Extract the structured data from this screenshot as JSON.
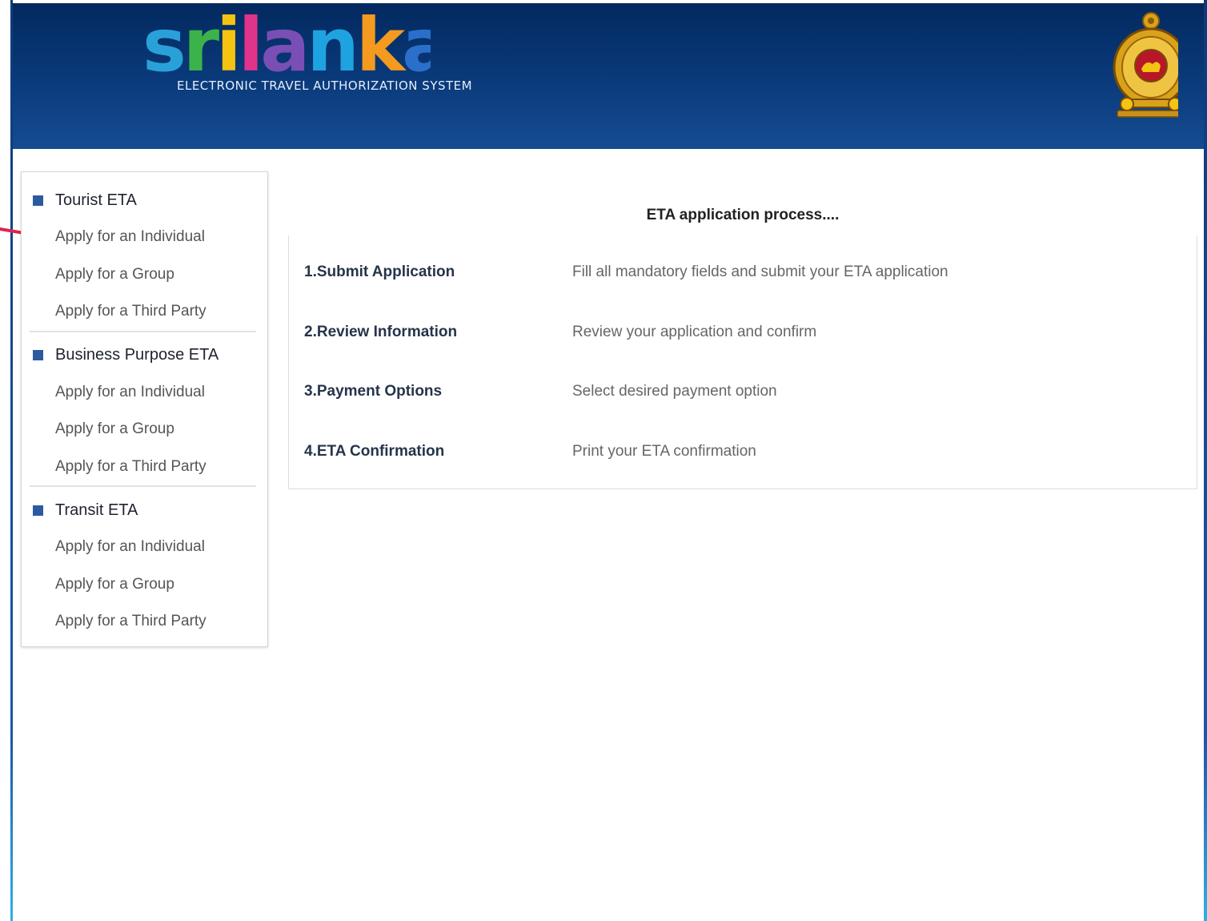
{
  "header": {
    "logo_text": "srilanka",
    "logo_subtitle": "ELECTRONIC TRAVEL AUTHORIZATION SYSTEM",
    "brand_colors": {
      "s": "#2aa0d8",
      "r": "#3cb34a",
      "i": "#f5c312",
      "l": "#e0338a",
      "a": "#7a4fb5",
      "n": "#1fa3e0",
      "k": "#f39a1f",
      "a2": "#2a6fc9"
    }
  },
  "sidebar": {
    "groups": [
      {
        "title": "Tourist ETA",
        "items": [
          "Apply for an Individual",
          "Apply for a Group",
          "Apply for a Third Party"
        ]
      },
      {
        "title": "Business Purpose ETA",
        "items": [
          "Apply for an Individual",
          "Apply for a Group",
          "Apply for a Third Party"
        ]
      },
      {
        "title": "Transit ETA",
        "items": [
          "Apply for an Individual",
          "Apply for a Group",
          "Apply for a Third Party"
        ]
      }
    ],
    "accent_color": "#2c5aa0"
  },
  "annotation": {
    "arrow_icon": "red-arrow-pointer",
    "arrow_color": "#e0224f"
  },
  "main": {
    "title": "ETA application process....",
    "steps": [
      {
        "label": "1.Submit Application",
        "description": "Fill all mandatory fields and submit your ETA application"
      },
      {
        "label": "2.Review Information",
        "description": "Review your application and confirm"
      },
      {
        "label": "3.Payment Options",
        "description": "Select desired payment option"
      },
      {
        "label": "4.ETA Confirmation",
        "description": "Print your ETA confirmation"
      }
    ]
  }
}
